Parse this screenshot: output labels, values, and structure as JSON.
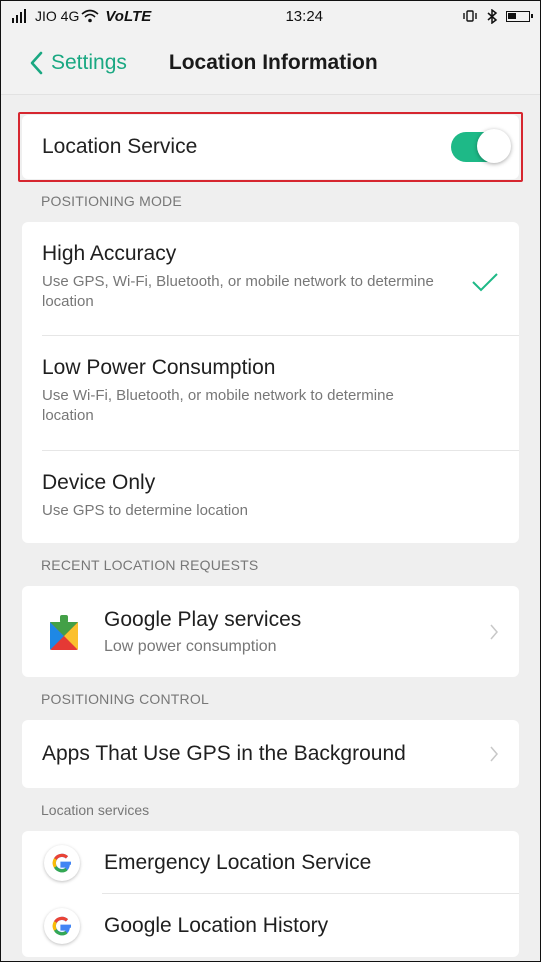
{
  "status_bar": {
    "carrier": "JIO 4G",
    "volte_prefix": "Vo",
    "volte_suffix": "LTE",
    "time": "13:24"
  },
  "header": {
    "back_label": "Settings",
    "title": "Location Information"
  },
  "location_service": {
    "label": "Location Service",
    "enabled": true
  },
  "positioning_mode": {
    "section_label": "POSITIONING MODE",
    "options": [
      {
        "title": "High Accuracy",
        "desc": "Use GPS, Wi-Fi, Bluetooth, or mobile network to determine location",
        "selected": true
      },
      {
        "title": "Low Power Consumption",
        "desc": "Use Wi-Fi, Bluetooth, or mobile network to determine location",
        "selected": false
      },
      {
        "title": "Device Only",
        "desc": "Use GPS to determine location",
        "selected": false
      }
    ]
  },
  "recent_requests": {
    "section_label": "RECENT LOCATION REQUESTS",
    "items": [
      {
        "title": "Google Play services",
        "desc": "Low power consumption"
      }
    ]
  },
  "positioning_control": {
    "section_label": "POSITIONING CONTROL",
    "item": "Apps That Use GPS in the Background"
  },
  "location_services": {
    "section_label": "Location services",
    "items": [
      "Emergency Location Service",
      "Google Location History"
    ]
  },
  "colors": {
    "accent": "#1eb987",
    "highlight_outline": "#d6262f"
  }
}
